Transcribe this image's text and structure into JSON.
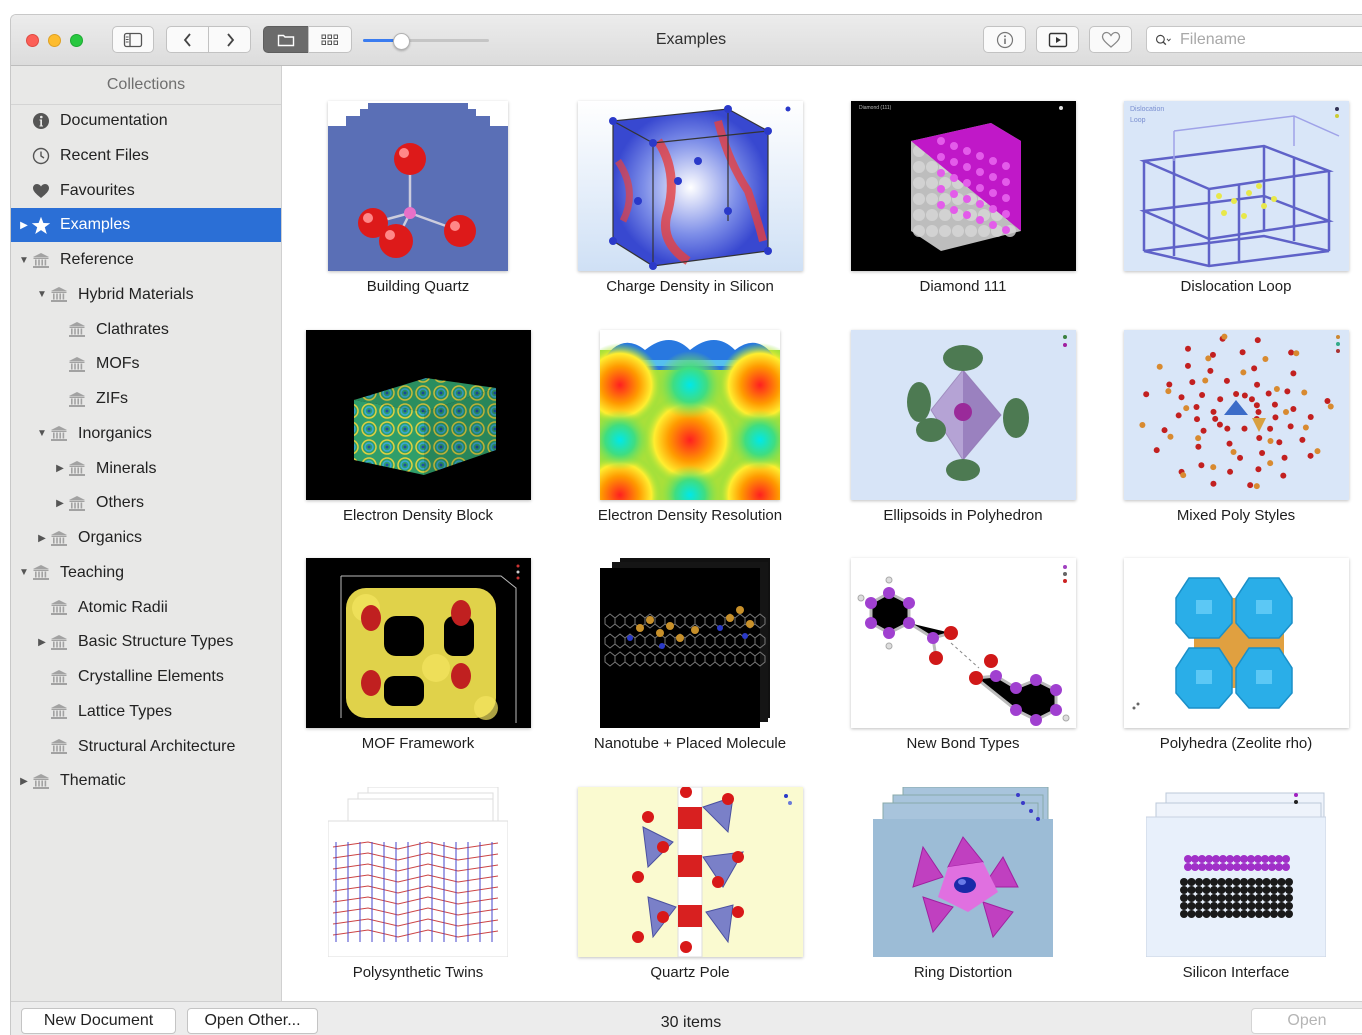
{
  "window": {
    "title": "Examples"
  },
  "search": {
    "placeholder": "Filename"
  },
  "sidebar": {
    "header": "Collections",
    "items": [
      {
        "label": "Documentation",
        "icon": "info-icon",
        "indent": 0,
        "disclosure": "none",
        "selected": false
      },
      {
        "label": "Recent Files",
        "icon": "clock-icon",
        "indent": 0,
        "disclosure": "none",
        "selected": false
      },
      {
        "label": "Favourites",
        "icon": "heart-icon",
        "indent": 0,
        "disclosure": "none",
        "selected": false
      },
      {
        "label": "Examples",
        "icon": "star-icon",
        "indent": 0,
        "disclosure": "collapsed",
        "selected": true
      },
      {
        "label": "Reference",
        "icon": "library-icon",
        "indent": 0,
        "disclosure": "expanded",
        "selected": false
      },
      {
        "label": "Hybrid Materials",
        "icon": "library-icon",
        "indent": 1,
        "disclosure": "expanded",
        "selected": false
      },
      {
        "label": "Clathrates",
        "icon": "library-icon",
        "indent": 2,
        "disclosure": "none",
        "selected": false
      },
      {
        "label": "MOFs",
        "icon": "library-icon",
        "indent": 2,
        "disclosure": "none",
        "selected": false
      },
      {
        "label": "ZIFs",
        "icon": "library-icon",
        "indent": 2,
        "disclosure": "none",
        "selected": false
      },
      {
        "label": "Inorganics",
        "icon": "library-icon",
        "indent": 1,
        "disclosure": "expanded",
        "selected": false
      },
      {
        "label": "Minerals",
        "icon": "library-icon",
        "indent": 2,
        "disclosure": "collapsed",
        "selected": false
      },
      {
        "label": "Others",
        "icon": "library-icon",
        "indent": 2,
        "disclosure": "collapsed",
        "selected": false
      },
      {
        "label": "Organics",
        "icon": "library-icon",
        "indent": 1,
        "disclosure": "collapsed",
        "selected": false
      },
      {
        "label": "Teaching",
        "icon": "library-icon",
        "indent": 0,
        "disclosure": "expanded",
        "selected": false
      },
      {
        "label": "Atomic Radii",
        "icon": "library-icon",
        "indent": 1,
        "disclosure": "none",
        "selected": false
      },
      {
        "label": "Basic Structure Types",
        "icon": "library-icon",
        "indent": 1,
        "disclosure": "collapsed",
        "selected": false
      },
      {
        "label": "Crystalline Elements",
        "icon": "library-icon",
        "indent": 1,
        "disclosure": "none",
        "selected": false
      },
      {
        "label": "Lattice Types",
        "icon": "library-icon",
        "indent": 1,
        "disclosure": "none",
        "selected": false
      },
      {
        "label": "Structural Architecture",
        "icon": "library-icon",
        "indent": 1,
        "disclosure": "none",
        "selected": false
      },
      {
        "label": "Thematic",
        "icon": "library-icon",
        "indent": 0,
        "disclosure": "collapsed",
        "selected": false
      }
    ]
  },
  "zoom_slider": {
    "level": 0.3
  },
  "gallery": [
    {
      "caption": "Building Quartz",
      "art": "quartz",
      "stacked": false
    },
    {
      "caption": "Charge Density in Silicon",
      "art": "charge",
      "stacked": false
    },
    {
      "caption": "Diamond 111",
      "art": "diamond",
      "stacked": false
    },
    {
      "caption": "Dislocation Loop",
      "art": "dislocation",
      "stacked": false
    },
    {
      "caption": "Electron Density Block",
      "art": "edblock",
      "stacked": false
    },
    {
      "caption": "Electron Density Resolution",
      "art": "edres",
      "stacked": false
    },
    {
      "caption": "Ellipsoids in Polyhedron",
      "art": "ellipsoids",
      "stacked": false
    },
    {
      "caption": "Mixed Poly Styles",
      "art": "mixedpoly",
      "stacked": false
    },
    {
      "caption": "MOF Framework",
      "art": "mof",
      "stacked": false
    },
    {
      "caption": "Nanotube + Placed Molecule",
      "art": "nanotube",
      "stacked": true
    },
    {
      "caption": "New Bond Types",
      "art": "bonds",
      "stacked": false
    },
    {
      "caption": "Polyhedra (Zeolite rho)",
      "art": "zeolite",
      "stacked": false
    },
    {
      "caption": "Polysynthetic Twins",
      "art": "twins",
      "stacked": true
    },
    {
      "caption": "Quartz Pole",
      "art": "quartzpole",
      "stacked": false
    },
    {
      "caption": "Ring Distortion",
      "art": "ring",
      "stacked": true
    },
    {
      "caption": "Silicon Interface",
      "art": "silicon",
      "stacked": true
    }
  ],
  "thumbnail_text": {
    "diamond_label": "Diamond (111)",
    "dislocation_label_1": "Dislocation",
    "dislocation_label_2": "Loop"
  },
  "bottom_bar": {
    "new_document": "New Document",
    "open_other": "Open Other...",
    "item_count": "30 items",
    "open": "Open"
  },
  "colors": {
    "selection": "#2b6fd6",
    "close": "#fc5f57",
    "minimize": "#fdbc2e",
    "zoom": "#28c840",
    "slider": "#3a7cf0"
  }
}
